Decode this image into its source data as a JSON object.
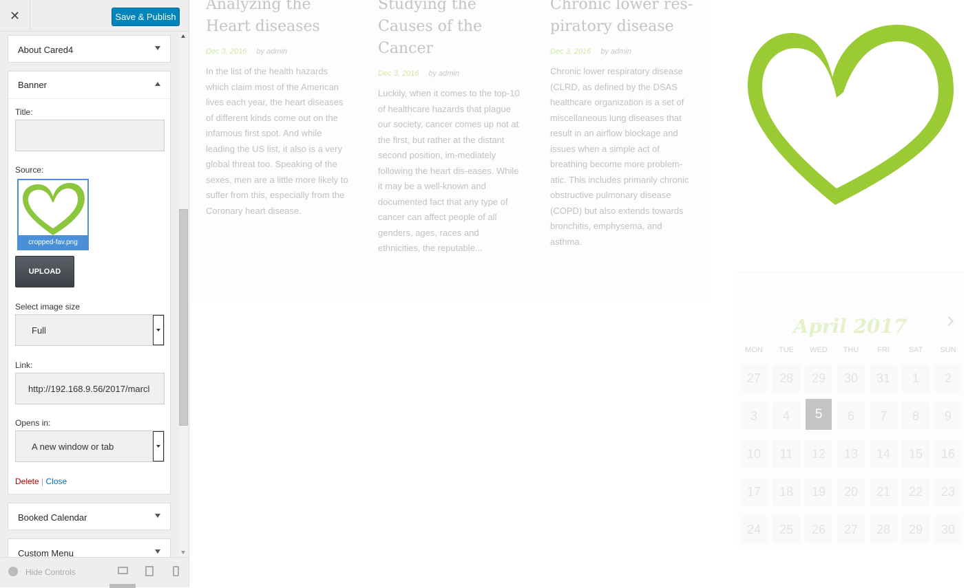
{
  "header": {
    "close_icon": "close-icon",
    "save_label": "Save & Publish"
  },
  "sections": {
    "about": "About Cared4",
    "banner": "Banner",
    "booked": "Booked Calendar",
    "custom_menu": "Custom Menu"
  },
  "banner": {
    "title_label": "Title:",
    "title_value": "",
    "source_label": "Source:",
    "image_name": "cropped-fav.png",
    "upload_label": "UPLOAD",
    "size_label": "Select image size",
    "size_value": "Full",
    "link_label": "Link:",
    "link_value": "http://192.168.9.56/2017/marcl",
    "opens_label": "Opens in:",
    "opens_value": "A new window or tab",
    "delete_label": "Delete",
    "separator": "|",
    "close_label": "Close"
  },
  "footer": {
    "hide_controls": "Hide Controls"
  },
  "posts": [
    {
      "title": "Analyzing the Heart diseases",
      "date": "Dec 3, 2016",
      "author": "by admin",
      "body": "In the list of the health hazards which claim most of the American lives each year, the heart diseases of different kinds come out on the infamous first spot. And while leading the US list, it also is a very global threat too. Speaking of the sexes, men are a little more likely to suffer from this, especially from the Coronary heart disease."
    },
    {
      "title": "Studying the Causes of the Cancer",
      "date": "Dec 3, 2016",
      "author": "by admin",
      "body": "Luckily, when it comes to the top-10 of healthcare hazards that plague our society, cancer comes up not at the first, but rather at the distant second position, im-mediately following the heart dis-eases. While it may be a well-known and documented fact that any type of cancer can affect people of all genders, ages, races and ethnicities, the reputable..."
    },
    {
      "title": "Chronic lower res-piratory disease",
      "date": "Dec 3, 2016",
      "author": "by admin",
      "body": "Chronic lower respiratory disease (CLRD, as defined by the DSAS healthcare organization is a set of miscellaneous lung diseases that result in an airflow blockage and issues when a simple act of breathing become more problem-atic. This includes primarily chronic obstructive pulmonary disease (COPD) but also extends towards bronchitis, emphysema, and asthma."
    }
  ],
  "calendar": {
    "title": "April 2017",
    "dow": [
      "MON",
      "TUE",
      "WED",
      "THU",
      "FRI",
      "SAT",
      "SUN"
    ],
    "days": [
      "27",
      "28",
      "29",
      "30",
      "31",
      "1",
      "2",
      "3",
      "4",
      "5",
      "6",
      "7",
      "8",
      "9",
      "10",
      "11",
      "12",
      "13",
      "14",
      "15",
      "16",
      "17",
      "18",
      "19",
      "20",
      "21",
      "22",
      "23",
      "24",
      "25",
      "26",
      "27",
      "28",
      "29",
      "30"
    ],
    "selected": "5"
  },
  "colors": {
    "accent": "#9fce3a",
    "primary": "#0085ba"
  }
}
